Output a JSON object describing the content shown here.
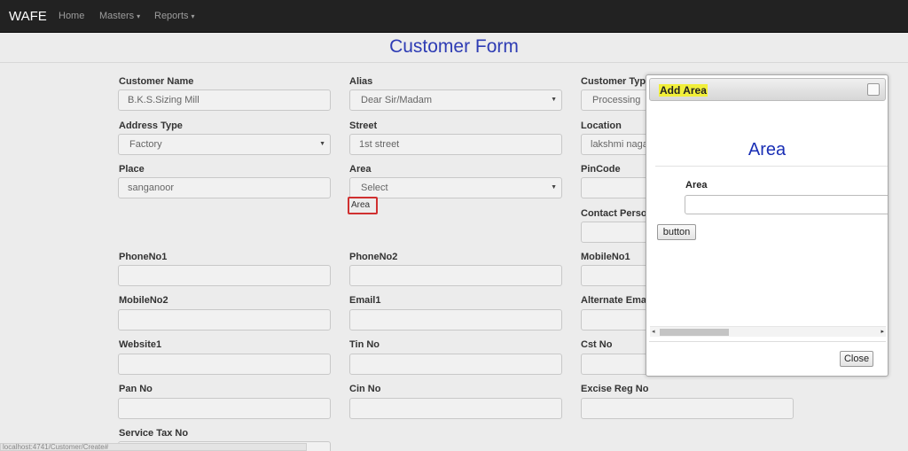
{
  "navbar": {
    "brand": "WAFE",
    "items": [
      {
        "label": "Home"
      },
      {
        "label": "Masters",
        "caret": "▾"
      },
      {
        "label": "Reports",
        "caret": "▾"
      }
    ]
  },
  "page": {
    "title": "Customer Form"
  },
  "form": {
    "customer_name": {
      "label": "Customer Name",
      "value": "B.K.S.Sizing Mill"
    },
    "alias": {
      "label": "Alias",
      "value": "Dear Sir/Madam"
    },
    "customer_type": {
      "label": "Customer Type",
      "value": "Processing"
    },
    "address_type": {
      "label": "Address Type",
      "value": "Factory"
    },
    "street": {
      "label": "Street",
      "value": "1st street"
    },
    "location": {
      "label": "Location",
      "value": "lakshmi nagar,"
    },
    "place": {
      "label": "Place",
      "value": "sanganoor"
    },
    "area": {
      "label": "Area",
      "value": "Select",
      "link": "Area"
    },
    "pincode": {
      "label": "PinCode",
      "value": ""
    },
    "contact_person": {
      "label": "Contact Person",
      "value": ""
    },
    "phone1": {
      "label": "PhoneNo1",
      "value": ""
    },
    "phone2": {
      "label": "PhoneNo2",
      "value": ""
    },
    "mobile1": {
      "label": "MobileNo1",
      "value": ""
    },
    "mobile2": {
      "label": "MobileNo2",
      "value": ""
    },
    "email1": {
      "label": "Email1",
      "value": ""
    },
    "alt_email": {
      "label": "Alternate Email",
      "value": ""
    },
    "website1": {
      "label": "Website1",
      "value": ""
    },
    "tin": {
      "label": "Tin No",
      "value": ""
    },
    "cst": {
      "label": "Cst No",
      "value": ""
    },
    "pan": {
      "label": "Pan No",
      "value": ""
    },
    "cin": {
      "label": "Cin No",
      "value": ""
    },
    "excise": {
      "label": "Excise Reg No",
      "value": ""
    },
    "service_tax": {
      "label": "Service Tax No",
      "value": ""
    }
  },
  "dialog": {
    "title": "Add Area",
    "heading": "Area",
    "field_label": "Area",
    "field_value": "",
    "button_label": "button",
    "close_label": "Close",
    "scroll_left": "◂",
    "scroll_right": "▸"
  },
  "statusbar": {
    "url": "localhost:4741/Customer/Create#"
  },
  "colors": {
    "accent": "#2e3cb4",
    "highlight": "#f1ef3a",
    "annotation": "#d03030"
  }
}
